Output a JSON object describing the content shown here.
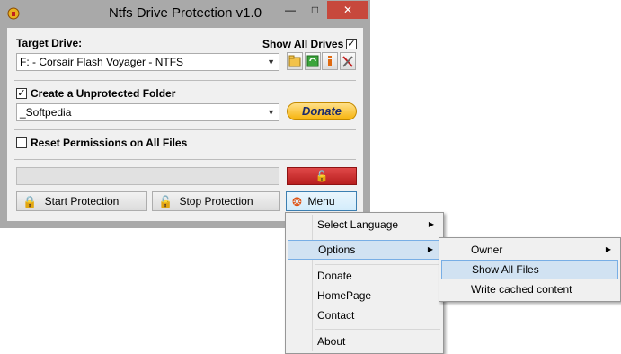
{
  "window": {
    "title": "Ntfs Drive Protection v1.0",
    "minimize_icon": "minimize-icon",
    "maximize_icon": "maximize-icon",
    "close_icon": "close-icon",
    "accent_close": "#c7483c"
  },
  "target_drive": {
    "label": "Target Drive:",
    "show_all_label": "Show All Drives",
    "show_all_checked": true,
    "selected": "F: - Corsair Flash Voyager - NTFS",
    "buttons": [
      "open-folder-icon",
      "refresh-icon",
      "info-icon",
      "tools-icon"
    ]
  },
  "unprotected_folder": {
    "label": "Create a Unprotected Folder",
    "checked": true,
    "selected": "_Softpedia",
    "donate_label": "Donate"
  },
  "reset_permissions": {
    "label": "Reset Permissions on All Files",
    "checked": false
  },
  "actions": {
    "start_label": "Start Protection",
    "stop_label": "Stop Protection",
    "menu_label": "Menu"
  },
  "context_menu": {
    "select_language": "Select Language",
    "options": "Options",
    "donate": "Donate",
    "homepage": "HomePage",
    "contact": "Contact",
    "about": "About"
  },
  "options_submenu": {
    "owner": "Owner",
    "show_all_files": "Show All Files",
    "write_cached": "Write cached content"
  }
}
